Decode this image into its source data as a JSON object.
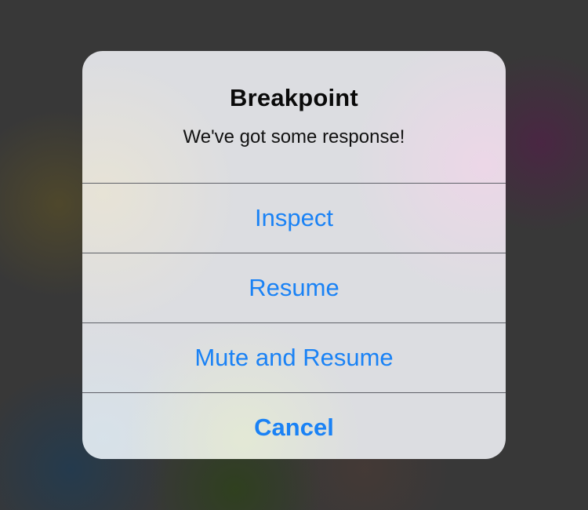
{
  "alert": {
    "title": "Breakpoint",
    "message": "We've got some response!",
    "actions": [
      {
        "label": "Inspect"
      },
      {
        "label": "Resume"
      },
      {
        "label": "Mute and Resume"
      },
      {
        "label": "Cancel"
      }
    ]
  },
  "colors": {
    "action_text": "#1a82f5",
    "title_text": "#0a0a0a",
    "dim_background": "#383838"
  }
}
